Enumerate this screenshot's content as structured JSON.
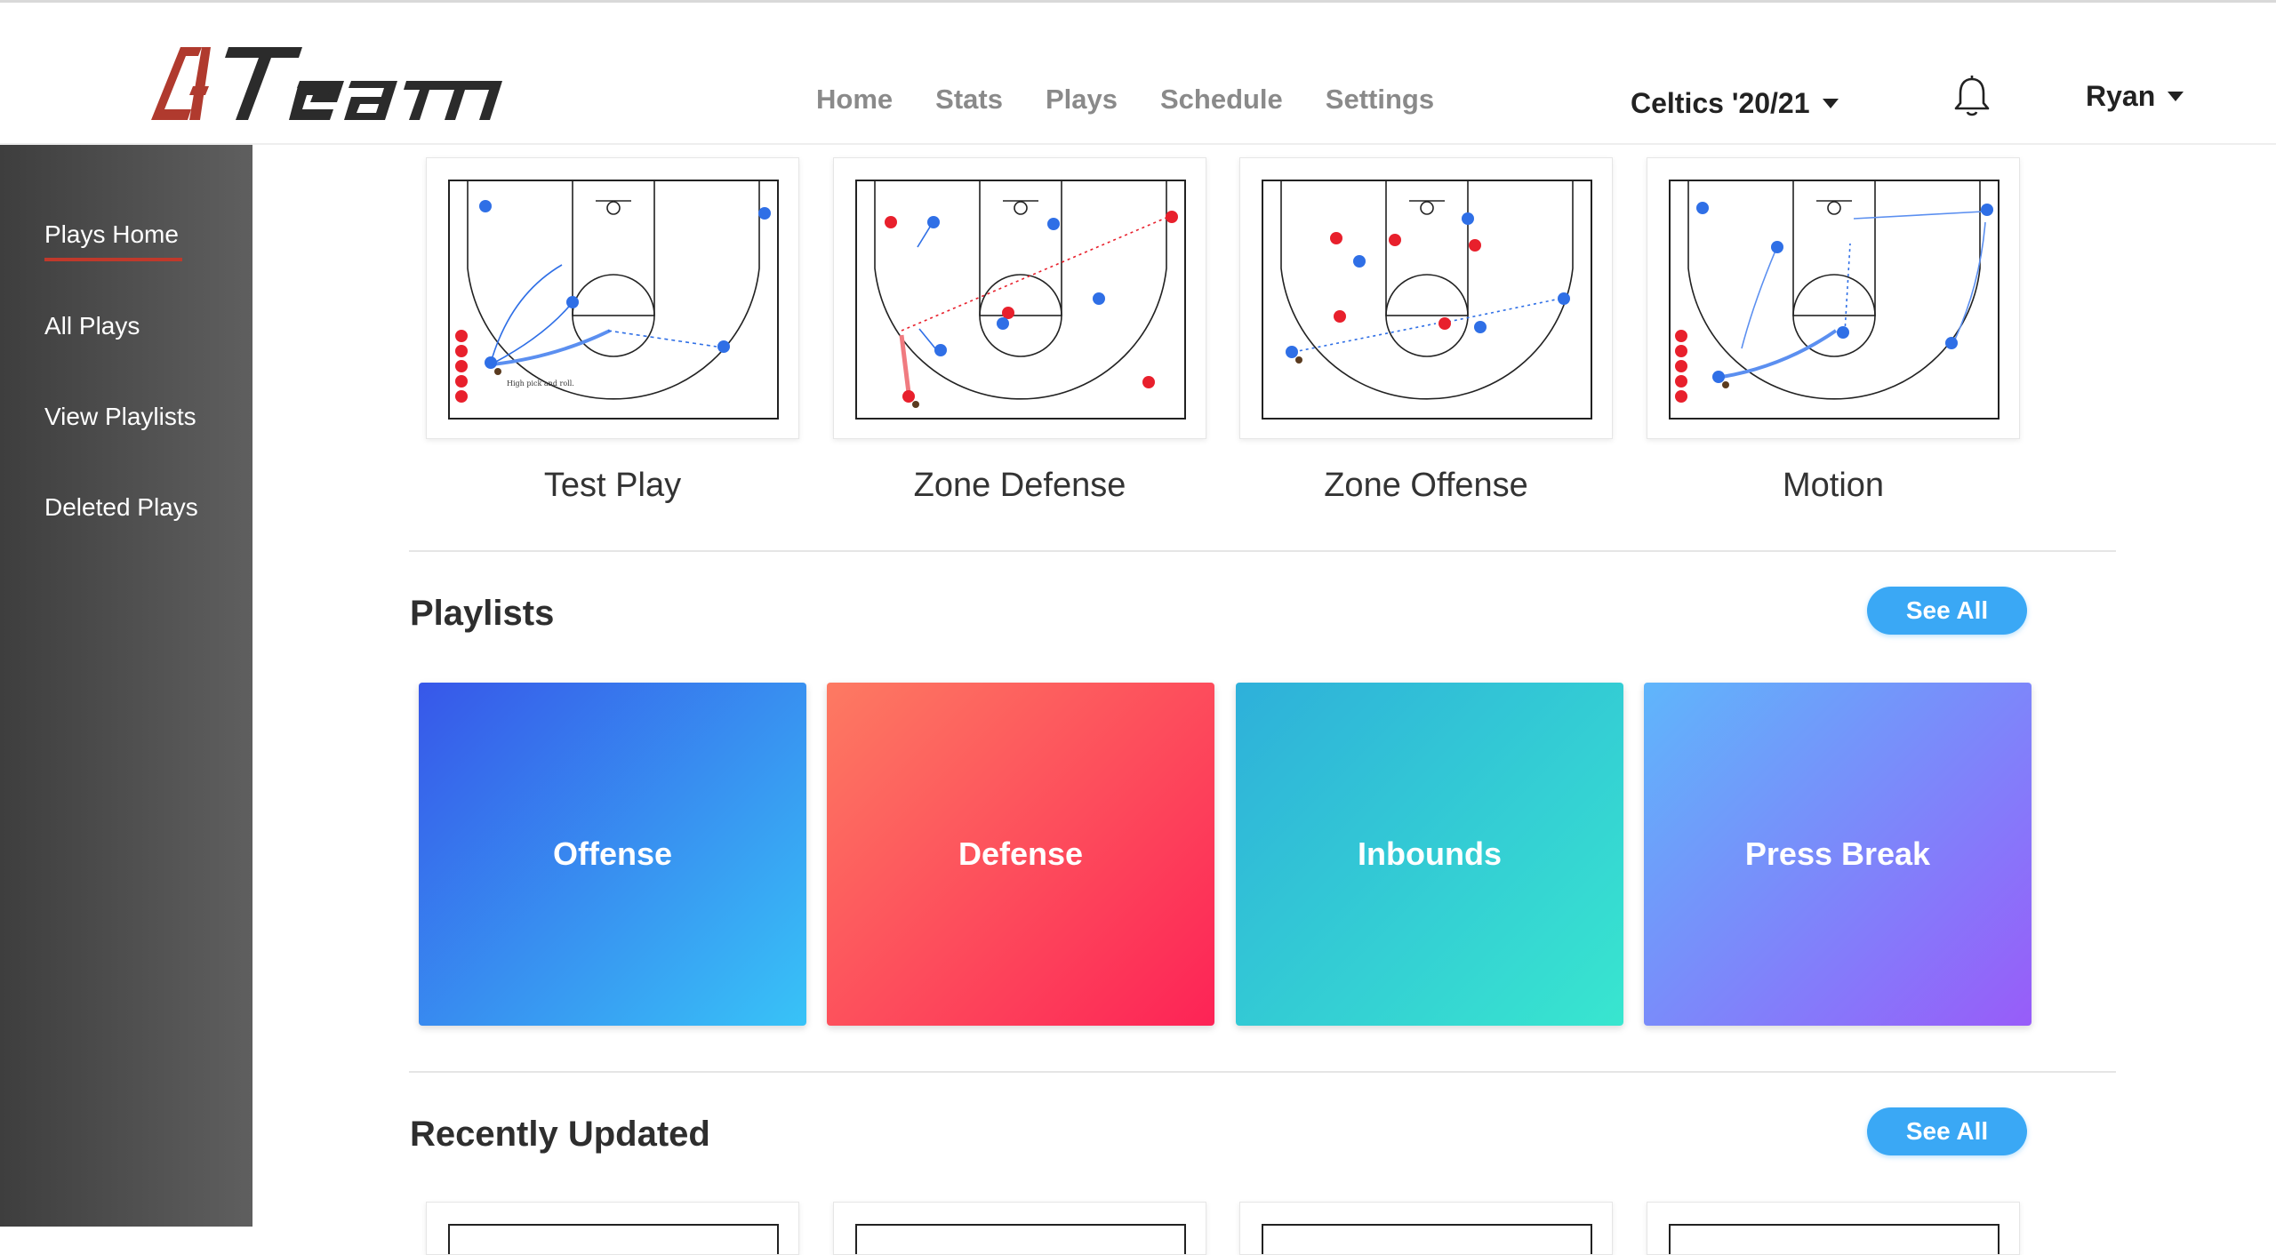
{
  "brand": {
    "logo_text": "ATeam",
    "accent": "#b03a2e"
  },
  "nav": {
    "items": [
      "Home",
      "Stats",
      "Plays",
      "Schedule",
      "Settings"
    ]
  },
  "header": {
    "team": "Celtics '20/21",
    "user": "Ryan"
  },
  "sidebar": {
    "items": [
      {
        "label": "Plays Home",
        "active": true
      },
      {
        "label": "All Plays"
      },
      {
        "label": "View Playlists"
      },
      {
        "label": "Deleted Plays"
      }
    ]
  },
  "plays": [
    {
      "title": "Test Play",
      "note": "High pick and roll."
    },
    {
      "title": "Zone Defense"
    },
    {
      "title": "Zone Offense"
    },
    {
      "title": "Motion"
    }
  ],
  "playlists": {
    "title": "Playlists",
    "see_all": "See All",
    "items": [
      {
        "label": "Offense",
        "colors": [
          "#3757e9",
          "#38c3f7"
        ]
      },
      {
        "label": "Defense",
        "colors": [
          "#fd7a62",
          "#fd2356"
        ]
      },
      {
        "label": "Inbounds",
        "colors": [
          "#2eb0da",
          "#38e6cf"
        ]
      },
      {
        "label": "Press Break",
        "colors": [
          "#5fb6fb",
          "#985cf9"
        ]
      }
    ]
  },
  "recent": {
    "title": "Recently Updated",
    "see_all": "See All"
  },
  "colors": {
    "player_blue": "#2f6fe6",
    "player_red": "#e8202c",
    "button_blue": "#3aa8f5"
  }
}
